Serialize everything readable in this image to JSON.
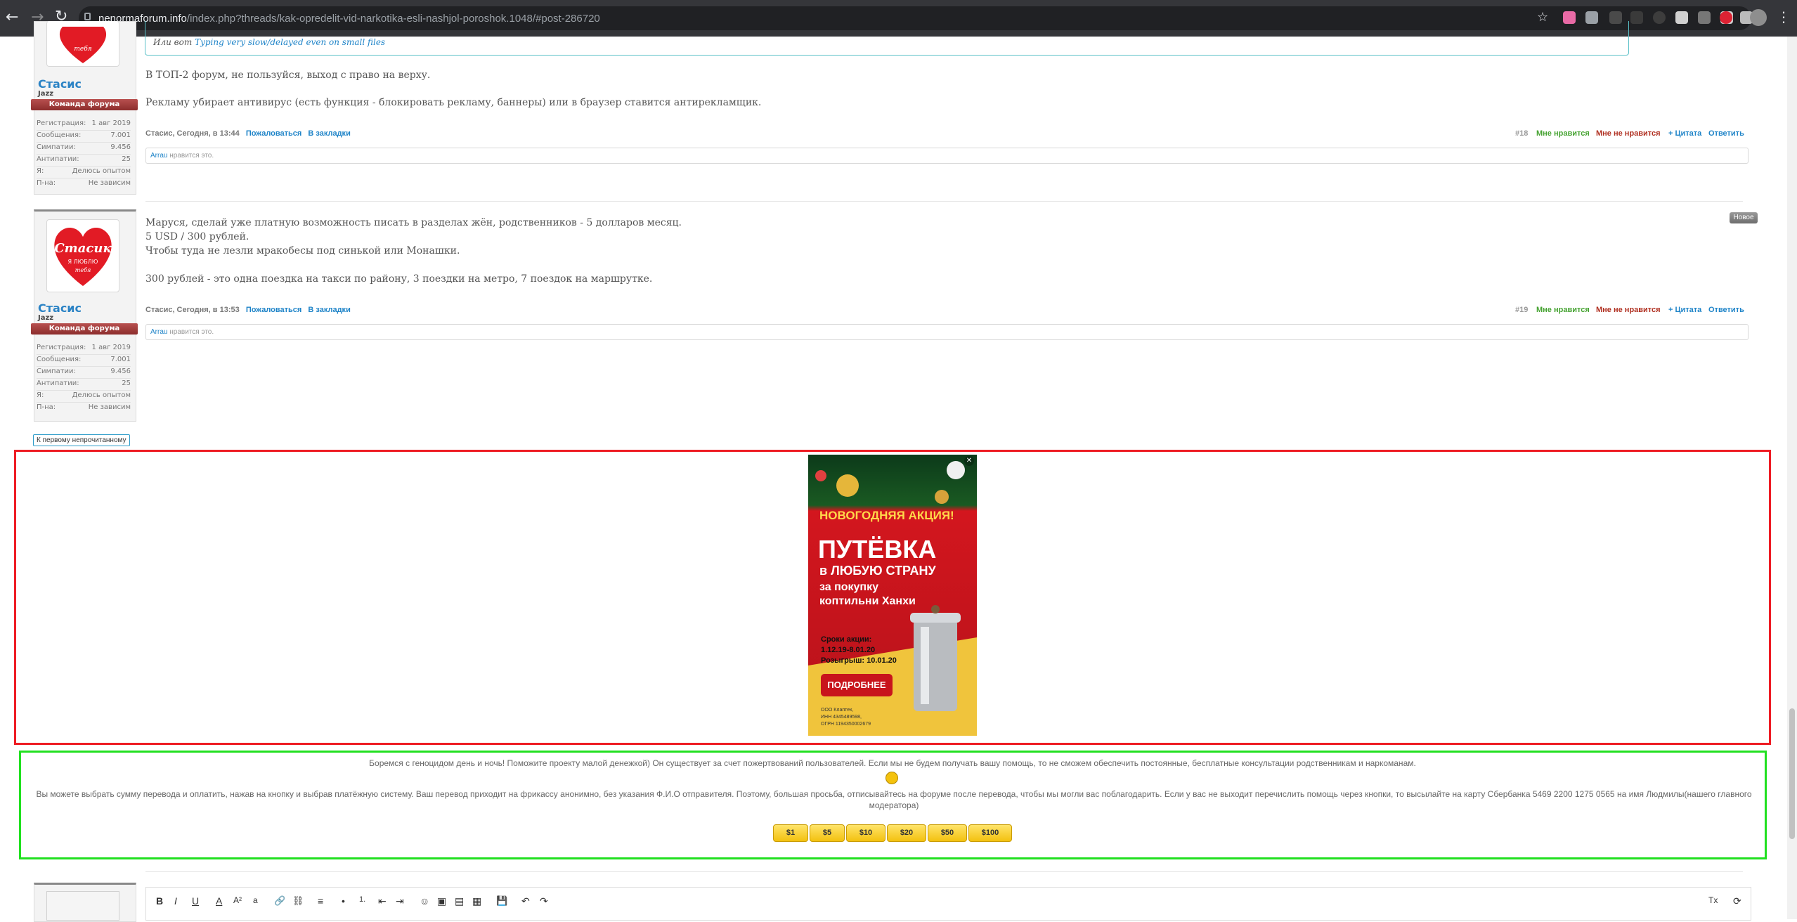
{
  "browser": {
    "url_host": "nenormaforum.info",
    "url_path": "/index.php?threads/kak-opredelit-vid-narkotika-esli-nashjol-poroshok.1048/#post-286720"
  },
  "quote": {
    "line1": "Или вот",
    "line1_link": "Typing very slow/delayed even on small files"
  },
  "posts": [
    {
      "username": "Стасис",
      "user_title": "Jazz",
      "ribbon": "Команда форума",
      "stats": [
        {
          "label": "Регистрация:",
          "value": "1 авг 2019"
        },
        {
          "label": "Сообщения:",
          "value": "7.001"
        },
        {
          "label": "Симпатии:",
          "value": "9.456"
        },
        {
          "label": "Антипатии:",
          "value": "25"
        },
        {
          "label": "Я:",
          "value": "Делюсь опытом"
        },
        {
          "label": "П-на:",
          "value": "Не зависим"
        }
      ],
      "text": [
        "В ТОП-2 форум, не пользуйся, выход с право на верху.",
        "Рекламу убирает антивирус (есть функция - блокировать рекламу, баннеры) или в браузер ставится антирекламщик."
      ],
      "meta_author": "Стасис, Сегодня, в 13:44",
      "complain": "Пожаловаться",
      "bookmark": "В закладки",
      "num": "#18",
      "like": "Мне нравится",
      "dislike": "Мне не нравится",
      "quote": "+ Цитата",
      "reply": "Ответить",
      "likes_user": "Arrau",
      "likes_text": "нравится это."
    },
    {
      "username": "Стасис",
      "user_title": "Jazz",
      "ribbon": "Команда форума",
      "stats": [
        {
          "label": "Регистрация:",
          "value": "1 авг 2019"
        },
        {
          "label": "Сообщения:",
          "value": "7.001"
        },
        {
          "label": "Симпатии:",
          "value": "9.456"
        },
        {
          "label": "Антипатии:",
          "value": "25"
        },
        {
          "label": "Я:",
          "value": "Делюсь опытом"
        },
        {
          "label": "П-на:",
          "value": "Не зависим"
        }
      ],
      "text": [
        "Маруся, сделай уже платную возможность писать в разделах жён, родственников - 5 долларов месяц.",
        "5 USD / 300 рублей.",
        "Чтобы туда не лезли мракобесы под синькой или Монашки.",
        "300 рублей - это одна поездка на такси по району, 3 поездки на метро, 7 поездок на маршрутке."
      ],
      "meta_author": "Стасис, Сегодня, в 13:53",
      "complain": "Пожаловаться",
      "bookmark": "В закладки",
      "num": "#19",
      "like": "Мне нравится",
      "dislike": "Мне не нравится",
      "quote": "+ Цитата",
      "reply": "Ответить",
      "likes_user": "Arrau",
      "likes_text": "нравится это.",
      "new_badge": "Новое"
    }
  ],
  "first_unread": "К первому непрочитанному",
  "ad": {
    "close": "✕",
    "headline": "НОВОГОДНЯЯ АКЦИЯ!",
    "big1": "ПУТЁВКА",
    "big2": "в ЛЮБУЮ СТРАНУ",
    "big3": "за покупку",
    "big4": "коптильни Ханхи",
    "dates1": "Сроки акции:",
    "dates2": "1.12.19-8.01.20",
    "dates3": "Розыгрыш: 10.01.20",
    "button": "ПОДРОБНЕЕ",
    "legal1": "ООО Клаптех,",
    "legal2": "ИНН 4345489598,",
    "legal3": "ОГРН 1194350002679"
  },
  "donation": {
    "line1": "Боремся с геноцидом день и ночь! Поможите проекту малой денежкой) Он существует за счет пожертвований пользователей. Если мы не будем получать вашу помощь, то не сможем обеспечить постоянные, бесплатные консультации родственникам и наркоманам.",
    "line2": "Вы можете выбрать сумму перевода и оплатить, нажав на кнопку и выбрав платёжную систему. Ваш перевод приходит на фрикассу анонимно, без указания Ф.И.О отправителя. Поэтому, большая просьба, отписывайтесь на форуме после перевода, чтобы мы могли вас поблагодарить. Если у вас не выходит перечислить помощь через кнопки, то высылайте на карту Сбербанка 5469 2200 1275 0565 на имя Людмилы(нашего главного модератора)",
    "amounts": [
      "$1",
      "$5",
      "$10",
      "$20",
      "$50",
      "$100"
    ]
  },
  "toolbar": [
    "B",
    "I",
    "U",
    "A",
    "A²",
    "a",
    "🔗",
    "⛓",
    "≡",
    "•",
    "1.",
    "⇤",
    "⇥",
    "☺",
    "▣",
    "▤",
    "▦",
    "💾",
    "↶",
    "↷",
    "Tx",
    "⟳"
  ]
}
